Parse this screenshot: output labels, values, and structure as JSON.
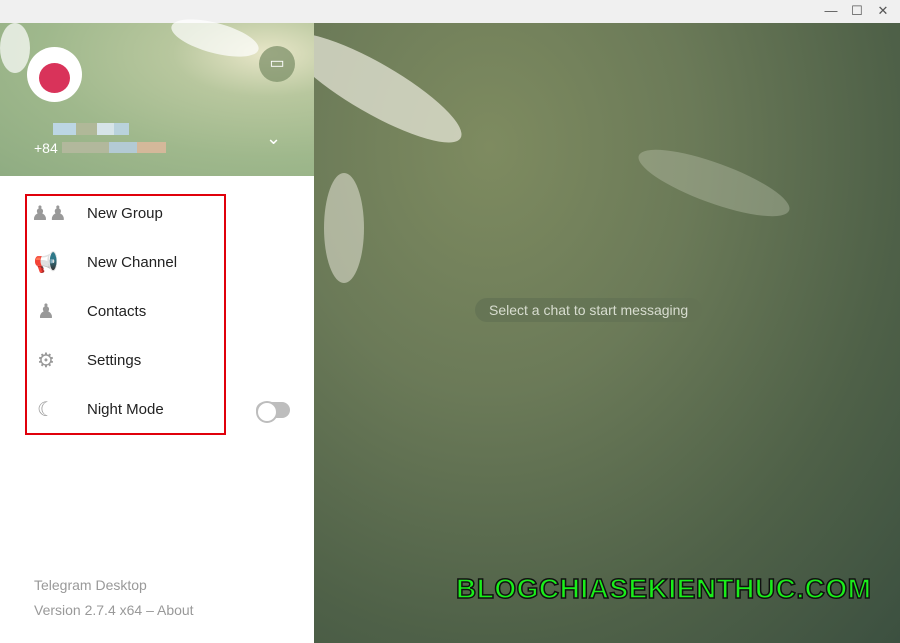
{
  "window": {
    "minimize_icon": "minimize-icon",
    "maximize_icon": "maximize-icon",
    "close_icon": "close-icon"
  },
  "profile": {
    "phone": "+84"
  },
  "menu": [
    {
      "label": "New Group",
      "icon": "group-icon"
    },
    {
      "label": "New Channel",
      "icon": "megaphone-icon"
    },
    {
      "label": "Contacts",
      "icon": "person-icon"
    },
    {
      "label": "Settings",
      "icon": "gear-icon"
    },
    {
      "label": "Night Mode",
      "icon": "moon-icon",
      "toggle": false
    }
  ],
  "footer": {
    "app": "Telegram Desktop",
    "version": "Version 2.7.4 x64 – ",
    "about": "About"
  },
  "chat": {
    "empty_text": "Select a chat to start messaging"
  },
  "watermark": "BLOGCHIASEKIENTHUC.COM",
  "colors": {
    "highlight": "#e0000b",
    "watermark": "#1aee1a"
  }
}
